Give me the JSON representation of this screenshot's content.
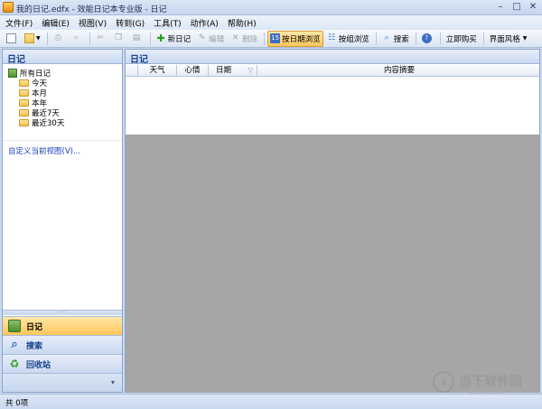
{
  "window": {
    "title": "我的日记.edfx - 效能日记本专业版 - 日记",
    "min_glyph": "–",
    "max_glyph": "□",
    "close_glyph": "✕"
  },
  "menu": [
    "文件(F)",
    "编辑(E)",
    "视图(V)",
    "转到(G)",
    "工具(T)",
    "动作(A)",
    "帮助(H)"
  ],
  "toolbar": {
    "new_diary": "新日记",
    "edit": "编辑",
    "delete": "删除",
    "by_date": "按日期浏览",
    "by_group": "按组浏览",
    "search": "搜索",
    "buy_now": "立即购买",
    "skin": "界面风格"
  },
  "left_pane": {
    "title": "日记",
    "tree_root": "所有日记",
    "tree_items": [
      "今天",
      "本月",
      "本年",
      "最近7天",
      "最近30天"
    ],
    "custom_view": "自定义当前视图(V)..."
  },
  "nav": {
    "diary": "日记",
    "search": "搜索",
    "recycle": "回收站"
  },
  "right_pane": {
    "title": "日记",
    "columns": [
      "天气",
      "心情",
      "日期",
      "内容摘要"
    ]
  },
  "status": "共 0项",
  "watermark": {
    "text": "当下软件园",
    "sub": "downxia.com"
  },
  "colors": {
    "accent": "#ffc75a",
    "header_text": "#15428b",
    "preview_bg": "#a6a6a6"
  }
}
